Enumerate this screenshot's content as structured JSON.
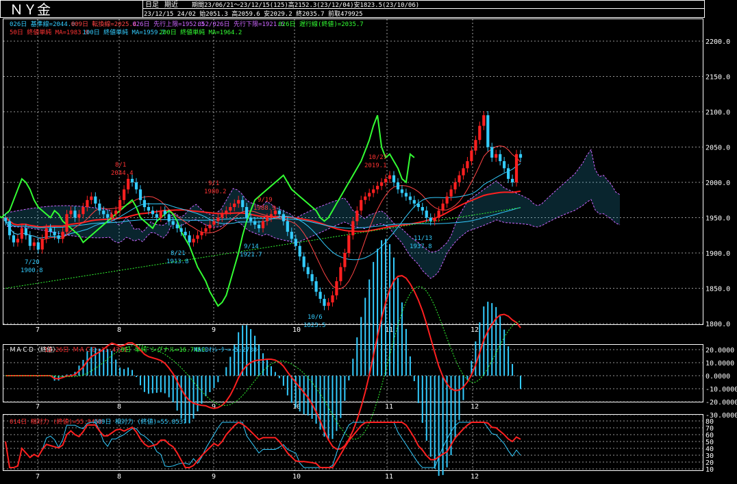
{
  "header": {
    "symbol": "ＮＹ金",
    "period_type": "日足",
    "contract": "期近",
    "period_info": "期間23/06/21～23/12/15(125)高2152.3(23/12/04)安1823.5(23/10/06)",
    "last_bar": "23/12/15 24/02 始2051.3 高2059.6 安2029.2 終2035.7 前取479925"
  },
  "legends": {
    "row1": [
      {
        "text": "026日 基準線=2044.0",
        "color": "#33ccff"
      },
      {
        "text": "009日 転換線=2025.4",
        "color": "#ff4444"
      },
      {
        "text": "026日 先行上限=1952.3",
        "color": "#cc66ff"
      },
      {
        "text": "052/026日 先行下限=1921.6",
        "color": "#cc66ff"
      },
      {
        "text": "026日 遅行線(終値)=2035.7",
        "color": "#33ff33"
      }
    ],
    "row2": [
      {
        "text": "50日 終値単純 MA=1983.9",
        "color": "#ff3333"
      },
      {
        "text": "100日 終値単純 MA=1959.7",
        "color": "#33ccff"
      },
      {
        "text": "200日 終値単純 MA=1964.2",
        "color": "#33ff33"
      }
    ],
    "macd": [
      {
        "text": "ＭＡＣＤ（終値）",
        "color": "#ffffff"
      },
      {
        "text": "12-26日 ＭＡＣＤ=11.4721",
        "color": "#ff3333"
      },
      {
        "text": "9日 単純 シグナル=16.7459",
        "color": "#33ff33"
      },
      {
        "text": "MACDｵｼﾚｰﾀｰ=-5.2738",
        "color": "#33ccff"
      }
    ],
    "rsi": [
      {
        "text": "014日 相対力 (終値)=55.9458",
        "color": "#ff3333"
      },
      {
        "text": "009日 相対力 (終値)=55.8537",
        "color": "#33ccff"
      }
    ]
  },
  "x_month_labels": [
    "7",
    "8",
    "9",
    "10",
    "11",
    "12"
  ],
  "annotations": [
    {
      "date": "7/20",
      "value": "1900.8",
      "color": "#33ccff"
    },
    {
      "date": "8/21",
      "value": "1913.8",
      "color": "#33ccff"
    },
    {
      "date": "9/14",
      "value": "1921.7",
      "color": "#33ccff"
    },
    {
      "date": "10/6",
      "value": "1823.5",
      "color": "#33ccff"
    },
    {
      "date": "11/13",
      "value": "1937.8",
      "color": "#33ccff"
    },
    {
      "date": "8/1",
      "value": "2044.4",
      "color": "#ff3333"
    },
    {
      "date": "9/1",
      "value": "1980.2",
      "color": "#ff3333"
    },
    {
      "date": "9/19",
      "value": "1988.9",
      "color": "#ff3333"
    },
    {
      "date": "10/27",
      "value": "2019.1",
      "color": "#ff3333"
    }
  ],
  "chart_data": [
    {
      "type": "candlestick",
      "title": "ＮＹ金",
      "y_ticks": [
        2200.0,
        2150.0,
        2100.0,
        2050.0,
        2000.0,
        1950.0,
        1900.0,
        1850.0,
        1800.0
      ],
      "ylim": [
        1800,
        2210
      ],
      "candles_close": [
        1945,
        1925,
        1915,
        1920,
        1935,
        1925,
        1910,
        1915,
        1905,
        1920,
        1935,
        1930,
        1925,
        1920,
        1930,
        1955,
        1960,
        1950,
        1955,
        1965,
        1975,
        1980,
        1970,
        1960,
        1955,
        1950,
        1955,
        1960,
        1975,
        1990,
        2005,
        2000,
        1990,
        1975,
        1965,
        1960,
        1955,
        1950,
        1960,
        1955,
        1945,
        1940,
        1935,
        1930,
        1925,
        1915,
        1920,
        1925,
        1930,
        1935,
        1940,
        1945,
        1950,
        1955,
        1960,
        1965,
        1970,
        1975,
        1965,
        1950,
        1945,
        1940,
        1935,
        1945,
        1950,
        1955,
        1960,
        1955,
        1945,
        1930,
        1920,
        1910,
        1895,
        1880,
        1870,
        1860,
        1845,
        1835,
        1825,
        1830,
        1840,
        1860,
        1880,
        1900,
        1925,
        1945,
        1960,
        1975,
        1980,
        1985,
        1990,
        1995,
        2000,
        2005,
        2010,
        2000,
        1990,
        1985,
        1980,
        1975,
        1970,
        1965,
        1960,
        1950,
        1945,
        1950,
        1960,
        1970,
        1980,
        1990,
        2000,
        2010,
        2020,
        2030,
        2045,
        2060,
        2080,
        2095,
        2050,
        2035,
        2040,
        2030,
        2020,
        2005,
        2000,
        2040,
        2035
      ],
      "ichimoku": {
        "kijun_last": 2044.0,
        "tenkan_last": 2025.4,
        "senkou_a_last": 1952.3,
        "senkou_b_last": 1921.6,
        "chikou_last": 2035.7
      },
      "moving_averages": {
        "ma50_last": 1983.9,
        "ma100_last": 1959.7,
        "ma200_last": 1964.2
      }
    },
    {
      "type": "macd",
      "title": "ＭＡＣＤ（終値）",
      "y_ticks": [
        20.0,
        10.0,
        0.0,
        -10.0,
        -20.0,
        -30.0
      ],
      "ylim": [
        -33,
        33
      ],
      "last": {
        "macd": 11.4721,
        "signal": 16.7459,
        "oscillator": -5.2738
      }
    },
    {
      "type": "rsi",
      "title": "相対力",
      "y_ticks": [
        80,
        70,
        60,
        50,
        40,
        30,
        20,
        10
      ],
      "ylim": [
        5,
        85
      ],
      "last": {
        "rsi14": 55.9458,
        "rsi9": 55.8537
      }
    }
  ],
  "colors": {
    "background": "#000000",
    "grid": "#c8c8c8",
    "up": "#ff2020",
    "down": "#33ccff",
    "cloud": "#cc66ff"
  }
}
